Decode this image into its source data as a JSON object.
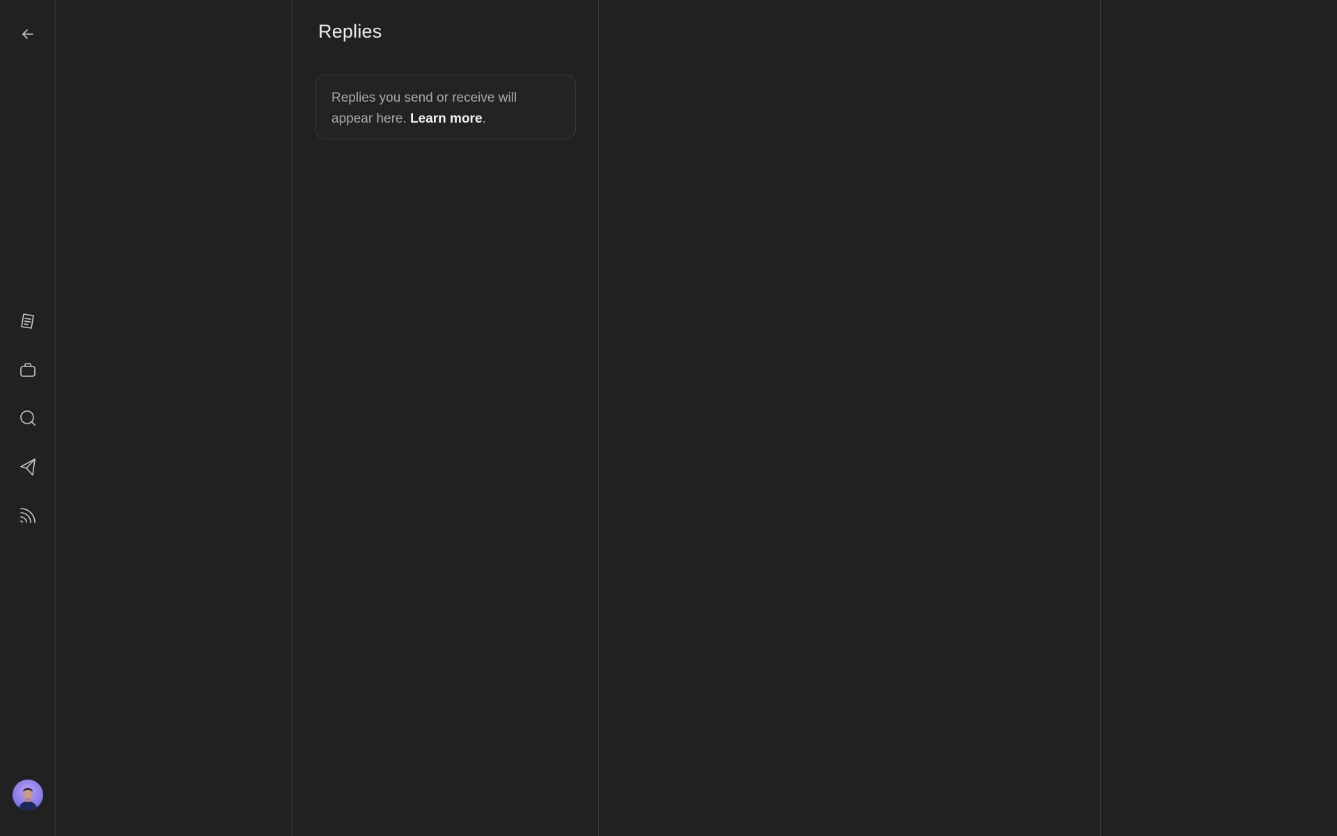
{
  "header": {
    "title": "Replies"
  },
  "empty_state": {
    "message": "Replies you send or receive will appear here.",
    "link_text": "Learn more",
    "suffix": "."
  },
  "rail": {
    "icons": [
      "back-arrow-icon",
      "notes-icon",
      "briefcase-icon",
      "search-icon",
      "send-icon",
      "feed-icon"
    ]
  },
  "colors": {
    "background": "#212121",
    "divider": "#3a3a3a",
    "text_primary": "#eeeeee",
    "text_secondary": "#a9a9a9"
  }
}
